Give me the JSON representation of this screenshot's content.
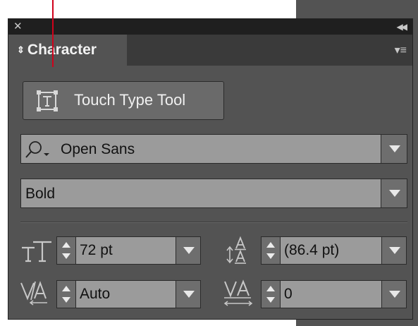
{
  "panel": {
    "tab_label": "Character",
    "touch_type_button": "Touch Type Tool",
    "font_family": "Open Sans",
    "font_style": "Bold",
    "font_size": "72 pt",
    "leading": "(86.4 pt)",
    "kerning": "Auto",
    "tracking": "0"
  },
  "icons": {
    "close": "close-icon",
    "collapse": "double-chevron-left-icon",
    "menu": "panel-menu-icon",
    "tab_arrows": "up-down-arrows-icon",
    "touch_type": "touch-type-icon",
    "search": "search-icon",
    "font_size": "font-size-icon",
    "leading": "leading-icon",
    "kerning": "kerning-icon",
    "tracking": "tracking-icon"
  },
  "colors": {
    "accent_line": "#d0021b",
    "panel_bg": "#535353",
    "field_bg": "#9b9b9b"
  }
}
